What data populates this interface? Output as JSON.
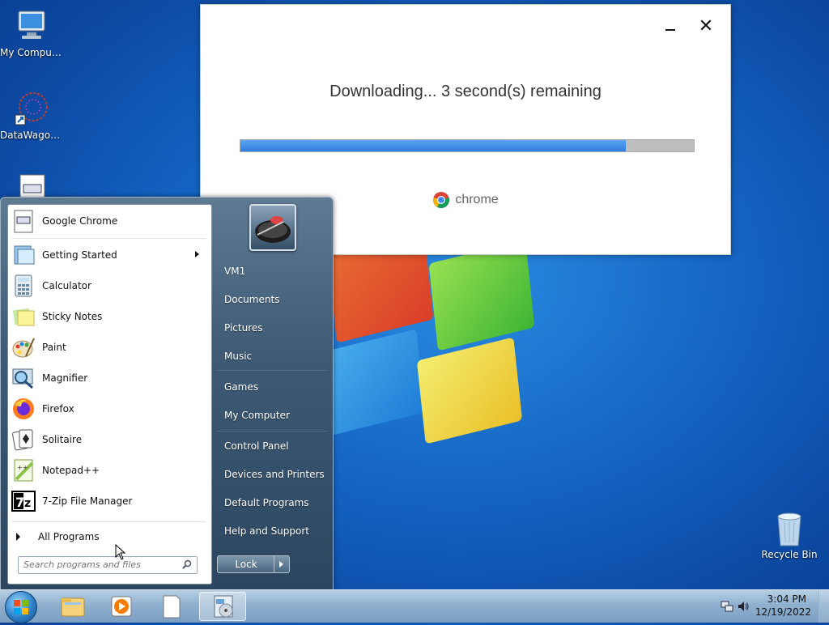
{
  "desktop": {
    "icons": [
      {
        "label": "My Computer"
      },
      {
        "label": "DataWagon..."
      },
      {
        "label": ""
      },
      {
        "label": "Recycle Bin"
      }
    ]
  },
  "download_dialog": {
    "status_text": "Downloading... 3 second(s) remaining",
    "progress_fraction": 0.85,
    "brand": "chrome",
    "minimize_icon": "minimize-icon",
    "close_glyph": "✕"
  },
  "start_menu": {
    "programs": [
      {
        "label": "Google Chrome",
        "icon": "chrome-installer-icon"
      },
      {
        "label": "Getting Started",
        "icon": "getting-started-icon",
        "submenu": true
      },
      {
        "label": "Calculator",
        "icon": "calculator-icon"
      },
      {
        "label": "Sticky Notes",
        "icon": "sticky-notes-icon"
      },
      {
        "label": "Paint",
        "icon": "paint-icon"
      },
      {
        "label": "Magnifier",
        "icon": "magnifier-icon"
      },
      {
        "label": "Firefox",
        "icon": "firefox-icon"
      },
      {
        "label": "Solitaire",
        "icon": "solitaire-icon"
      },
      {
        "label": "Notepad++",
        "icon": "notepadpp-icon"
      },
      {
        "label": "7-Zip File Manager",
        "icon": "7zip-icon"
      }
    ],
    "all_programs": "All Programs",
    "search_placeholder": "Search programs and files",
    "right_items": [
      {
        "label": "VM1"
      },
      {
        "label": "Documents"
      },
      {
        "label": "Pictures"
      },
      {
        "label": "Music"
      },
      {
        "label": "Games"
      },
      {
        "label": "My Computer"
      },
      {
        "label": "Control Panel"
      },
      {
        "label": "Devices and Printers"
      },
      {
        "label": "Default Programs"
      },
      {
        "label": "Help and Support"
      }
    ],
    "lock_label": "Lock"
  },
  "taskbar": {
    "time": "3:04 PM",
    "date": "12/19/2022"
  },
  "colors": {
    "progress_fill": "#2f7fe0",
    "progress_track": "#bdbdbd",
    "desktop_blue": "#1463c2"
  }
}
